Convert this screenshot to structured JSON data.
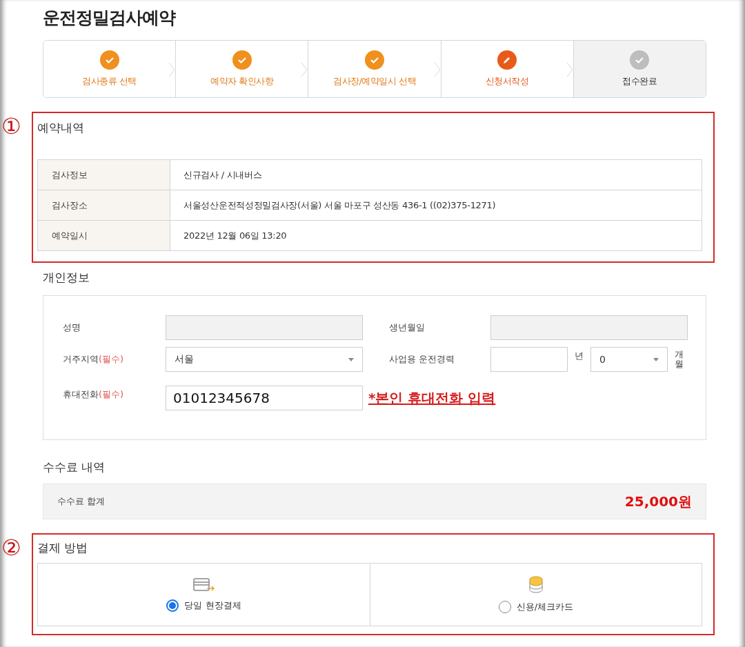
{
  "title": "운전정밀검사예약",
  "steps": [
    {
      "label": "검사종류 선택",
      "done": true,
      "current": false
    },
    {
      "label": "예약자 확인사항",
      "done": true,
      "current": false
    },
    {
      "label": "검사장/예약일시 선택",
      "done": true,
      "current": false
    },
    {
      "label": "신청서작성",
      "done": false,
      "current": true
    },
    {
      "label": "접수완료",
      "done": false,
      "current": false
    }
  ],
  "reservation": {
    "marker": "①",
    "heading": "예약내역",
    "rows": [
      {
        "label": "검사정보",
        "value": "신규검사 / 시내버스"
      },
      {
        "label": "검사장소",
        "value": "서울성산운전적성정밀검사장(서울) 서울 마포구 성산동 436-1 ((02)375-1271)"
      },
      {
        "label": "예약일시",
        "value": "2022년 12월 06일 13:20"
      }
    ]
  },
  "personal": {
    "heading": "개인정보",
    "fields": [
      {
        "kind": "text",
        "label": "성명",
        "disabled": true
      },
      {
        "kind": "text",
        "label": "생년월일",
        "disabled": true
      },
      {
        "kind": "select",
        "label": "거주지역",
        "required": "(필수)",
        "value": "서울"
      },
      {
        "kind": "career",
        "label": "사업용 운전경력",
        "year_unit": "년",
        "month_value": "0",
        "month_unit": "개월"
      },
      {
        "kind": "phone",
        "label": "휴대전화",
        "required": "(필수)",
        "value": "01012345678",
        "note": "*본인 휴대전화 입력"
      }
    ]
  },
  "fee": {
    "heading": "수수료 내역",
    "label": "수수료 합계",
    "amount": "25,000원"
  },
  "payment": {
    "marker": "②",
    "heading": "결제 방법",
    "options": [
      {
        "kind": "cash",
        "label": "당일 현장결제",
        "selected": true
      },
      {
        "kind": "card",
        "label": "신용/체크카드",
        "selected": false
      }
    ]
  }
}
